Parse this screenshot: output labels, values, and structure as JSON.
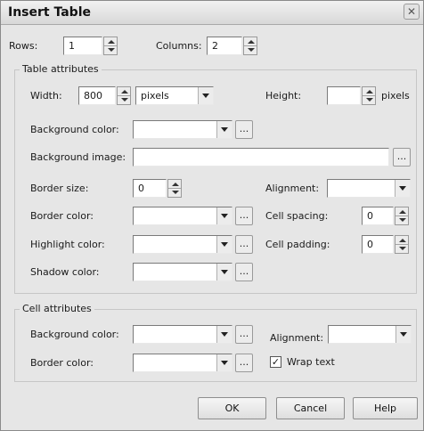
{
  "dialog": {
    "title": "Insert Table",
    "close_glyph": "✕"
  },
  "top": {
    "rows_label": "Rows:",
    "rows_value": "1",
    "columns_label": "Columns:",
    "columns_value": "2"
  },
  "table_attributes": {
    "legend": "Table attributes",
    "width_label": "Width:",
    "width_value": "800",
    "width_unit": "pixels",
    "height_label": "Height:",
    "height_value": "",
    "height_unit": "pixels",
    "bg_color_label": "Background color:",
    "bg_color_value": "",
    "bg_image_label": "Background image:",
    "bg_image_value": "",
    "border_size_label": "Border size:",
    "border_size_value": "0",
    "alignment_label": "Alignment:",
    "alignment_value": "",
    "border_color_label": "Border color:",
    "border_color_value": "",
    "cell_spacing_label": "Cell spacing:",
    "cell_spacing_value": "0",
    "highlight_color_label": "Highlight color:",
    "highlight_color_value": "",
    "cell_padding_label": "Cell padding:",
    "cell_padding_value": "0",
    "shadow_color_label": "Shadow color:",
    "shadow_color_value": ""
  },
  "cell_attributes": {
    "legend": "Cell attributes",
    "bg_color_label": "Background color:",
    "bg_color_value": "",
    "alignment_label": "Alignment:",
    "alignment_value": "",
    "border_color_label": "Border color:",
    "border_color_value": "",
    "wrap_text_label": "Wrap text",
    "wrap_text_checked": true,
    "check_glyph": "✓"
  },
  "ellipsis_label": "...",
  "buttons": {
    "ok": "OK",
    "cancel": "Cancel",
    "help": "Help"
  }
}
